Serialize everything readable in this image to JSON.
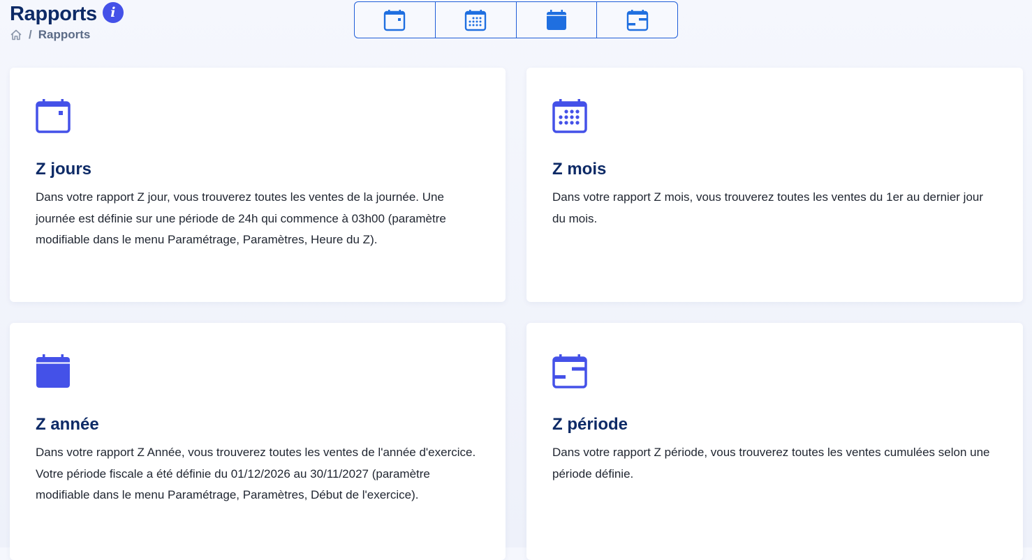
{
  "header": {
    "title": "Rapports",
    "info_icon_label": "i",
    "breadcrumb": {
      "separator": "/",
      "current": "Rapports"
    }
  },
  "toolbar": {
    "buttons": [
      {
        "icon": "calendar-day-icon"
      },
      {
        "icon": "calendar-month-icon"
      },
      {
        "icon": "calendar-year-icon"
      },
      {
        "icon": "calendar-range-icon"
      }
    ]
  },
  "cards": [
    {
      "icon": "calendar-day-icon",
      "title": "Z jours",
      "description": "Dans votre rapport Z jour, vous trouverez toutes les ventes de la journée. Une journée est définie sur une période de 24h qui commence à 03h00 (paramètre modifiable dans le menu Paramétrage, Paramètres, Heure du Z)."
    },
    {
      "icon": "calendar-month-icon",
      "title": "Z mois",
      "description": "Dans votre rapport Z mois, vous trouverez toutes les ventes du 1er au dernier jour du mois."
    },
    {
      "icon": "calendar-year-icon",
      "title": "Z année",
      "description": "Dans votre rapport Z Année, vous trouverez toutes les ventes de l'année d'exercice. Votre période fiscale a été définie du 01/12/2026 au 30/11/2027 (paramètre modifiable dans le menu Paramétrage, Paramètres, Début de l'exercice)."
    },
    {
      "icon": "calendar-range-icon",
      "title": "Z période",
      "description": "Dans votre rapport Z période, vous trouverez toutes les ventes cumulées selon une période définie."
    }
  ],
  "colors": {
    "title": "#0d2a66",
    "accent": "#4451e8",
    "toolbar_icon": "#1f6fe0",
    "background": "#f2f5fc"
  }
}
